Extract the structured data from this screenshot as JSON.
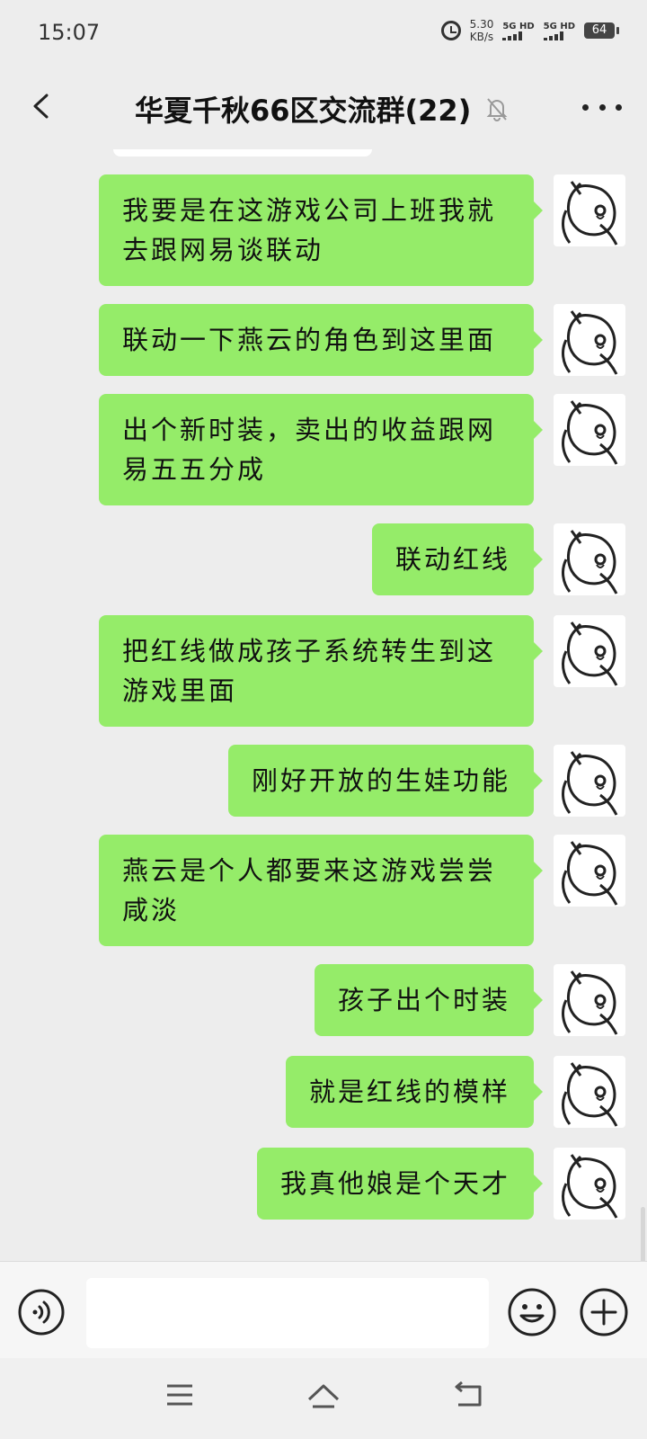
{
  "status_bar": {
    "time": "15:07",
    "net_speed_value": "5.30",
    "net_speed_unit": "KB/s",
    "sim1_label": "5G HD",
    "sim2_label": "5G HD",
    "battery": "64",
    "alarm_icon": "alarm-icon"
  },
  "header": {
    "back_icon": "chevron-left-icon",
    "title": "华夏千秋66区交流群(22)",
    "mute_icon": "bell-off-icon",
    "more_icon": "more-dots-icon"
  },
  "messages": [
    {
      "text": "我要是在这游戏公司上班我就去跟网易谈联动",
      "sender": "self"
    },
    {
      "text": "联动一下燕云的角色到这里面",
      "sender": "self"
    },
    {
      "text": "出个新时装，卖出的收益跟网易五五分成",
      "sender": "self"
    },
    {
      "text": "联动红线",
      "sender": "self"
    },
    {
      "text": "把红线做成孩子系统转生到这游戏里面",
      "sender": "self"
    },
    {
      "text": "刚好开放的生娃功能",
      "sender": "self"
    },
    {
      "text": "燕云是个人都要来这游戏尝尝咸淡",
      "sender": "self"
    },
    {
      "text": "孩子出个时装",
      "sender": "self"
    },
    {
      "text": "就是红线的模样",
      "sender": "self"
    },
    {
      "text": "我真他娘是个天才",
      "sender": "self"
    }
  ],
  "colors": {
    "bubble_self": "#95ec69",
    "background": "#ededed"
  },
  "input_bar": {
    "voice_icon": "voice-icon",
    "input_value": "",
    "emoji_icon": "emoji-icon",
    "plus_icon": "plus-icon"
  },
  "system_nav": {
    "menu_icon": "menu-icon",
    "home_icon": "home-icon",
    "back_icon": "back-arrow-icon"
  }
}
